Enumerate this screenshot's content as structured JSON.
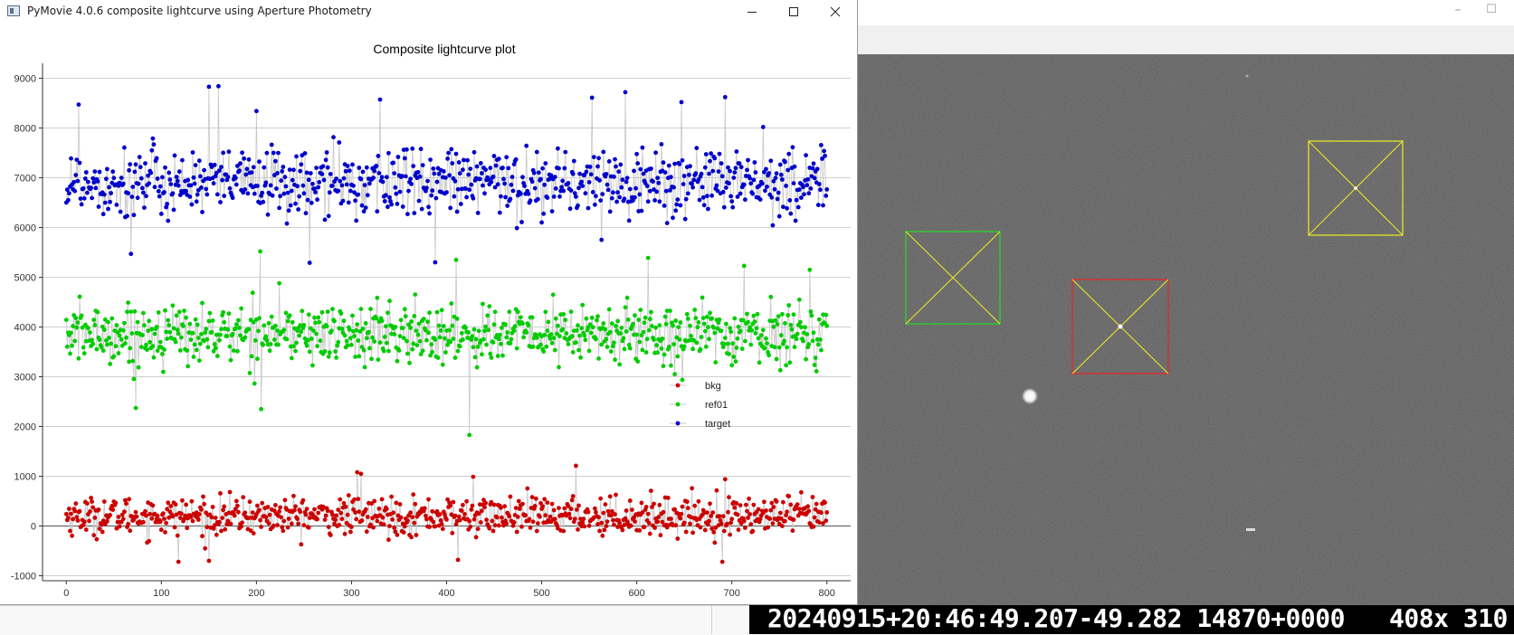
{
  "window": {
    "title": "PyMovie 4.0.6 composite lightcurve using Aperture Photometry"
  },
  "icons": {
    "app": "app-icon",
    "minimize": "minimize-icon",
    "maximize": "maximize-icon",
    "close": "close-icon"
  },
  "colors": {
    "bkg": "#cc0000",
    "ref01": "#00cc00",
    "target": "#0000cc",
    "connector": "#c8c8c8",
    "green_aperture": "#22dd22",
    "red_aperture": "#ee2222",
    "yellow_aperture": "#eeee22"
  },
  "timestamp": {
    "text": "20240915+20:46:49.207-49.282 14870+0000   408x 310"
  },
  "chart_data": {
    "type": "scatter",
    "title": "Composite lightcurve plot",
    "xlabel": "",
    "ylabel": "",
    "xlim": [
      -25,
      825
    ],
    "ylim": [
      -1100,
      9300
    ],
    "x_ticks": [
      0,
      100,
      200,
      300,
      400,
      500,
      600,
      700,
      800
    ],
    "y_ticks": [
      -1000,
      0,
      1000,
      2000,
      3000,
      4000,
      5000,
      6000,
      7000,
      8000,
      9000
    ],
    "grid": "horizontal",
    "legend_position": "right",
    "x_range": [
      0,
      800
    ],
    "series": [
      {
        "name": "bkg",
        "mean": 200,
        "spread": 300,
        "notable_points": [
          [
            306,
            1080
          ],
          [
            310,
            1050
          ],
          [
            428,
            990
          ],
          [
            536,
            1210
          ],
          [
            693,
            940
          ],
          [
            118,
            -720
          ],
          [
            150,
            -700
          ],
          [
            412,
            -680
          ],
          [
            690,
            -720
          ]
        ]
      },
      {
        "name": "ref01",
        "mean": 3850,
        "spread": 480,
        "notable_points": [
          [
            204,
            5520
          ],
          [
            224,
            4880
          ],
          [
            410,
            5350
          ],
          [
            424,
            1830
          ],
          [
            612,
            5390
          ],
          [
            713,
            5230
          ],
          [
            782,
            5150
          ],
          [
            73,
            2370
          ],
          [
            205,
            2350
          ]
        ]
      },
      {
        "name": "target",
        "mean": 6900,
        "spread": 560,
        "notable_points": [
          [
            13,
            8470
          ],
          [
            150,
            8830
          ],
          [
            160,
            8840
          ],
          [
            200,
            8340
          ],
          [
            330,
            8570
          ],
          [
            553,
            8610
          ],
          [
            588,
            8720
          ],
          [
            647,
            8520
          ],
          [
            693,
            8620
          ],
          [
            68,
            5470
          ],
          [
            256,
            5290
          ],
          [
            388,
            5300
          ]
        ]
      }
    ]
  }
}
